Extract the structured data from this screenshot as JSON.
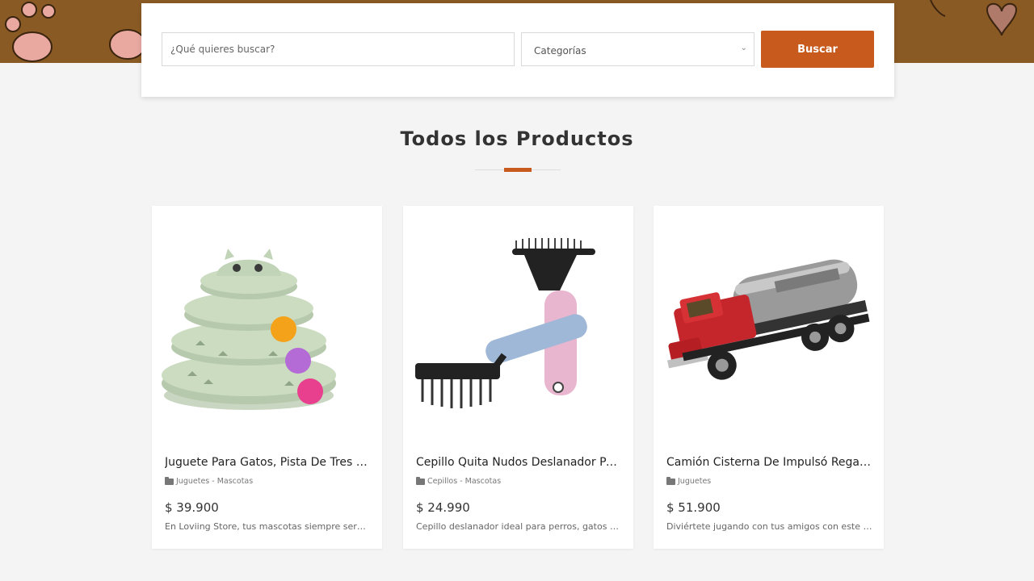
{
  "search": {
    "placeholder": "¿Qué quieres buscar?",
    "category_selected": "Categorías",
    "button_label": "Buscar"
  },
  "section": {
    "title": "Todos los Productos"
  },
  "colors": {
    "accent": "#c75a1c",
    "banner": "#8a5a24",
    "background": "#f4f4f4"
  },
  "products": [
    {
      "name": "Juguete Para Gatos, Pista De Tres Niveles",
      "category": "Juguetes - Mascotas",
      "price": "$ 39.900",
      "description": "En Loviing Store, tus mascotas siempre serán importantes",
      "image_icon": "cat-toy-tower-image"
    },
    {
      "name": "Cepillo Quita Nudos Deslanador Para Mascotas",
      "category": "Cepillos - Mascotas",
      "price": "$ 24.990",
      "description": "Cepillo deslanador ideal para perros, gatos y conejos",
      "image_icon": "grooming-brush-image"
    },
    {
      "name": "Camión Cisterna De Impulsó Regalo Para Niños",
      "category": "Juguetes",
      "price": "$ 51.900",
      "description": "Diviértete jugando con tus amigos con este Camión",
      "image_icon": "tanker-truck-image"
    }
  ]
}
